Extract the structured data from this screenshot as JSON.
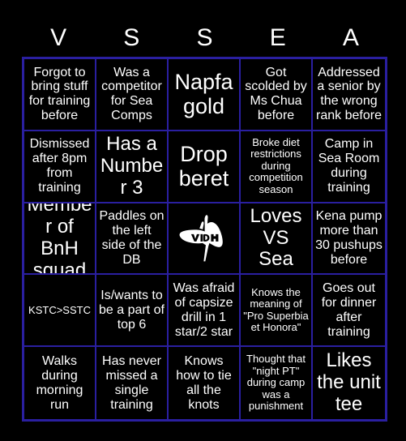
{
  "card": {
    "background_color": "#000000",
    "border_color": "#2a1fa0",
    "text_color": "#ffffff",
    "header_letters": [
      "V",
      "S",
      "S",
      "E",
      "A"
    ],
    "columns": 5,
    "rows": 5,
    "cells": [
      {
        "text": "Forgot to bring stuff for training before",
        "size": "md"
      },
      {
        "text": "Was a competitor for Sea Comps",
        "size": "md"
      },
      {
        "text": "Napfa gold",
        "size": "xxl"
      },
      {
        "text": "Got scolded by Ms Chua before",
        "size": "md"
      },
      {
        "text": "Addressed a senior by the wrong rank before",
        "size": "md"
      },
      {
        "text": "Dismissed after 8pm from training",
        "size": "md"
      },
      {
        "text": "Has a Number 3",
        "size": "xl"
      },
      {
        "text": "Drop beret",
        "size": "xxl"
      },
      {
        "text": "Broke diet restrictions during competition season",
        "size": "sm"
      },
      {
        "text": "Camp in Sea Room during training",
        "size": "md"
      },
      {
        "text": "Member of BnH squad",
        "size": "xl"
      },
      {
        "text": "Paddles on the left side of the DB",
        "size": "md"
      },
      {
        "text": "",
        "size": "md",
        "icon": "victoria-manta-ray-logo"
      },
      {
        "text": "Loves VS Sea",
        "size": "xl"
      },
      {
        "text": "Kena pump more than 30 pushups before",
        "size": "md"
      },
      {
        "text": "KSTC>SSTC",
        "size": "sm"
      },
      {
        "text": "Is/wants to be a part of top 6",
        "size": "md"
      },
      {
        "text": "Was afraid of capsize drill in 1 star/2 star",
        "size": "md"
      },
      {
        "text": "Knows the meaning of \"Pro Superbia et Honora\"",
        "size": "sm"
      },
      {
        "text": "Goes out for dinner after training",
        "size": "md"
      },
      {
        "text": "Walks during morning run",
        "size": "md"
      },
      {
        "text": "Has never missed a single training",
        "size": "md"
      },
      {
        "text": "Knows how to tie all the knots",
        "size": "md"
      },
      {
        "text": "Thought that \"night PT\" during camp was a punishment",
        "size": "sm"
      },
      {
        "text": "Likes the unit tee",
        "size": "xl"
      }
    ]
  }
}
